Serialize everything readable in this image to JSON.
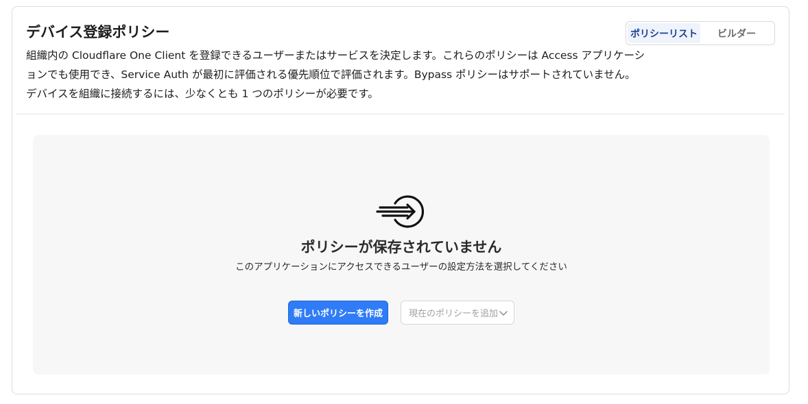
{
  "header": {
    "title": "デバイス登録ポリシー",
    "description_lines": [
      "組織内の Cloudflare One Client を登録できるユーザーまたはサービスを決定します。これらのポリシーは Access アプリケーシ",
      "ョンでも使用でき、Service Auth が最初に評価される優先順位で評価されます。Bypass ポリシーはサポートされていません。",
      "デバイスを組織に接続するには、少なくとも 1 つのポリシーが必要です。"
    ]
  },
  "view_toggle": {
    "policy_list": "ポリシーリスト",
    "builder": "ビルダー",
    "selected": "policy_list"
  },
  "empty_state": {
    "icon": "arrow-circle-enter-icon",
    "title": "ポリシーが保存されていません",
    "subtitle": "このアプリケーションにアクセスできるユーザーの設定方法を選択してください",
    "create_button": "新しいポリシーを作成",
    "add_existing_placeholder": "現在のポリシーを追加"
  },
  "colors": {
    "primary": "#2f7cf6",
    "active_tab_bg": "#eef3fc",
    "active_tab_text": "#1f3f8f",
    "empty_bg": "#f7f7f7"
  }
}
